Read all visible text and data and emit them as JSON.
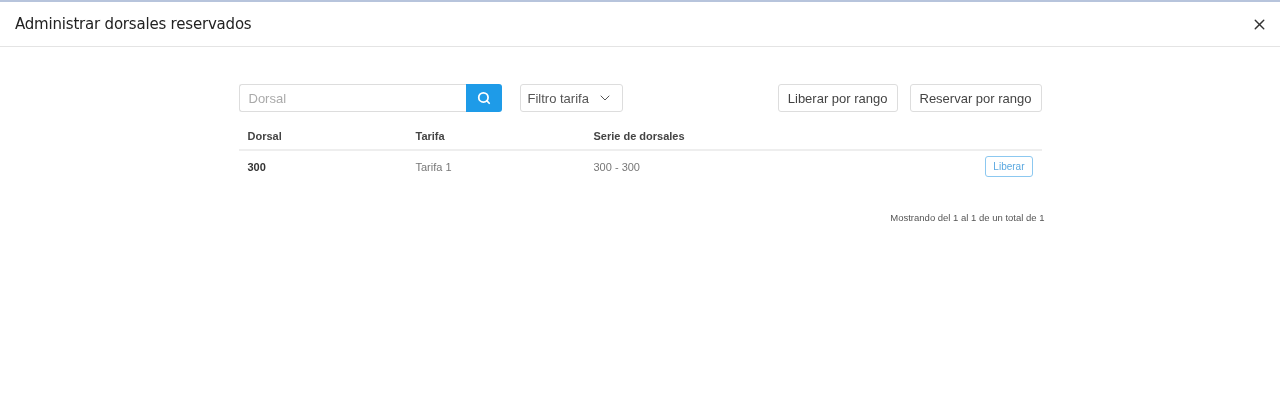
{
  "dialog": {
    "title": "Administrar dorsales reservados"
  },
  "search": {
    "placeholder": "Dorsal"
  },
  "filter": {
    "label": "Filtro tarifa"
  },
  "actions": [
    "Liberar por rango",
    "Reservar por rango"
  ],
  "table": {
    "columns": [
      "Dorsal",
      "Tarifa",
      "Serie de dorsales"
    ],
    "rows": [
      {
        "dorsal": "300",
        "tarifa": "Tarifa 1",
        "serie": "300 - 300",
        "action": "Liberar"
      }
    ]
  },
  "pagination": "Mostrando del 1 al 1 de un total de 1"
}
